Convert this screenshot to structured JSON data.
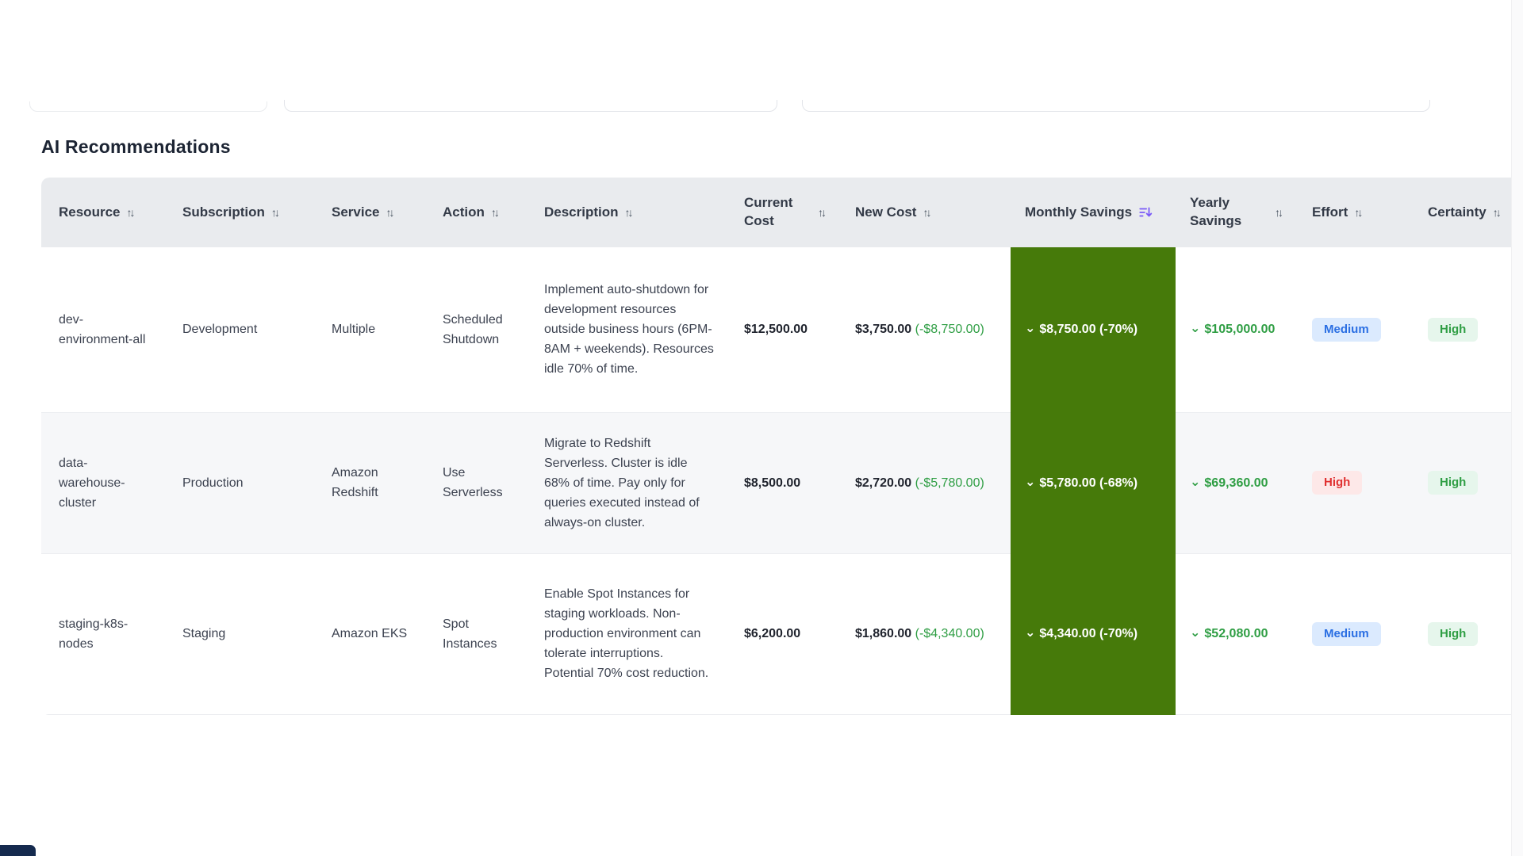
{
  "page": {
    "title": "AI Recommendations"
  },
  "icons": {
    "sort": "↑↓",
    "sort_active": "sort-descending",
    "chevron": "⌄"
  },
  "colors": {
    "monthly_savings_bg": "#467a0a",
    "positive_green": "#2f9e44",
    "effort_medium_blue": "#2b6fe3",
    "effort_high_red": "#e03131",
    "certainty_high_green": "#2f9e44",
    "active_sort_purple": "#7a5af8",
    "header_bg": "#e9ebee"
  },
  "table": {
    "columns": [
      {
        "label": "Resource"
      },
      {
        "label": "Subscription"
      },
      {
        "label": "Service"
      },
      {
        "label": "Action"
      },
      {
        "label": "Description"
      },
      {
        "label": "Current Cost"
      },
      {
        "label": "New Cost"
      },
      {
        "label": "Monthly Savings",
        "sorted": "desc"
      },
      {
        "label": "Yearly Savings"
      },
      {
        "label": "Effort"
      },
      {
        "label": "Certainty"
      }
    ],
    "rows": [
      {
        "resource": "dev-environment-all",
        "subscription": "Development",
        "service": "Multiple",
        "action": "Scheduled Shutdown",
        "description": "Implement auto-shutdown for development resources outside business hours (6PM-8AM + weekends). Resources idle 70% of time.",
        "current_cost": "$12,500.00",
        "new_cost": "$3,750.00",
        "new_cost_delta": "(-$8,750.00)",
        "monthly_savings": "$8,750.00 (-70%)",
        "yearly_savings": "$105,000.00",
        "effort": "Medium",
        "certainty": "High"
      },
      {
        "resource": "data-warehouse-cluster",
        "subscription": "Production",
        "service": "Amazon Redshift",
        "action": "Use Serverless",
        "description": "Migrate to Redshift Serverless. Cluster is idle 68% of time. Pay only for queries executed instead of always-on cluster.",
        "current_cost": "$8,500.00",
        "new_cost": "$2,720.00",
        "new_cost_delta": "(-$5,780.00)",
        "monthly_savings": "$5,780.00 (-68%)",
        "yearly_savings": "$69,360.00",
        "effort": "High",
        "certainty": "High"
      },
      {
        "resource": "staging-k8s-nodes",
        "subscription": "Staging",
        "service": "Amazon EKS",
        "action": "Spot Instances",
        "description": "Enable Spot Instances for staging workloads. Non-production environment can tolerate interruptions. Potential 70% cost reduction.",
        "current_cost": "$6,200.00",
        "new_cost": "$1,860.00",
        "new_cost_delta": "(-$4,340.00)",
        "monthly_savings": "$4,340.00 (-70%)",
        "yearly_savings": "$52,080.00",
        "effort": "Medium",
        "certainty": "High"
      }
    ]
  }
}
